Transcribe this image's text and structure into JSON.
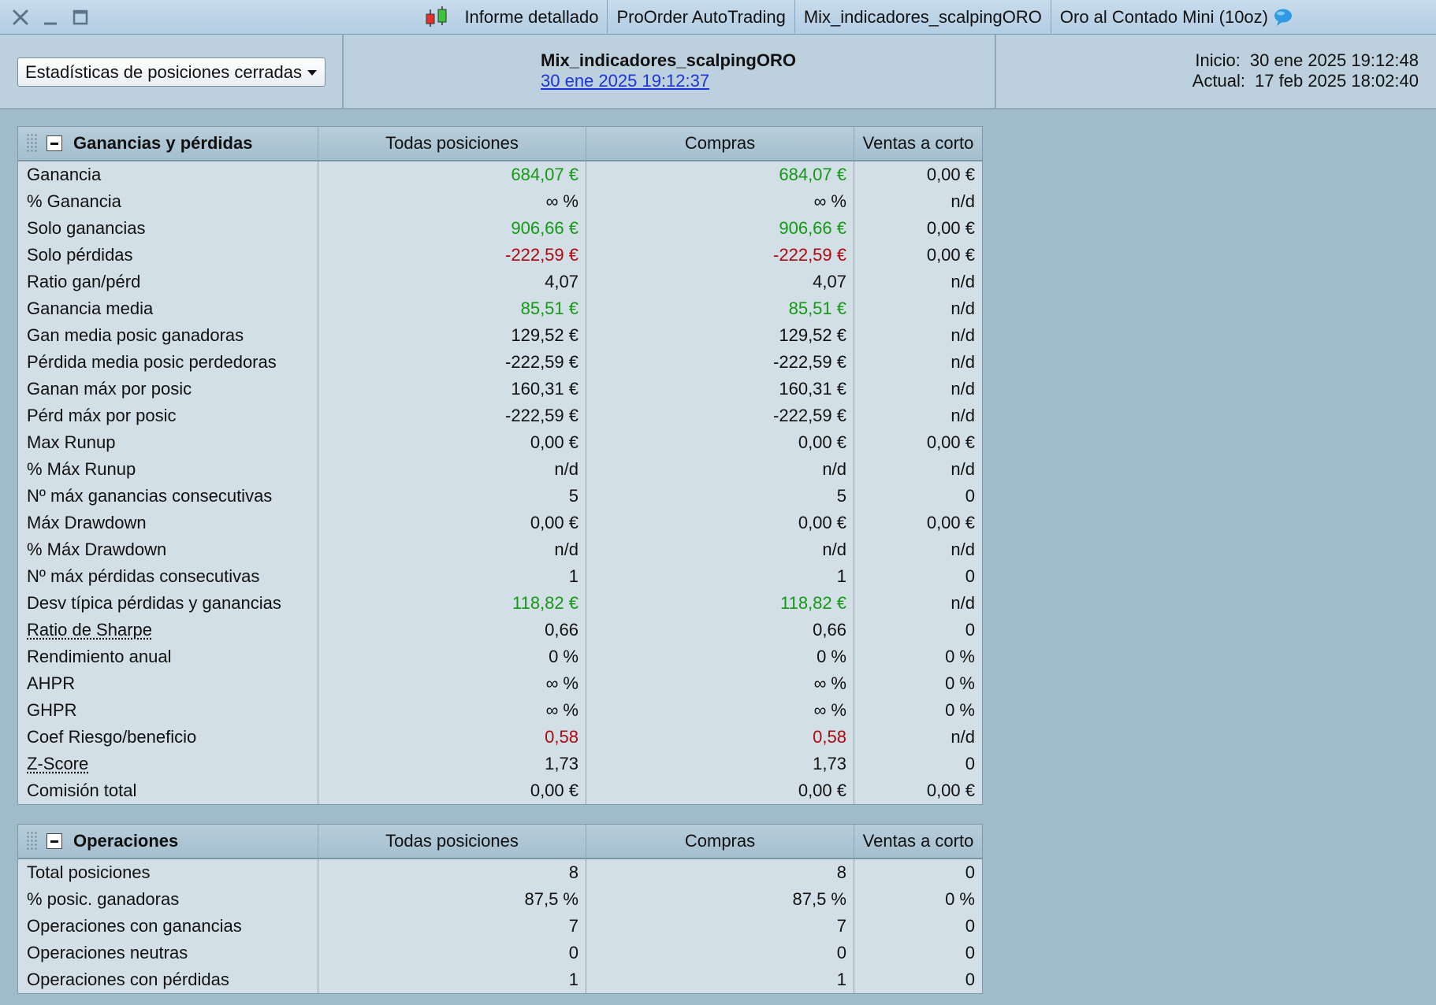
{
  "titlebar": {
    "tabs": [
      "Informe detallado",
      "ProOrder AutoTrading",
      "Mix_indicadores_scalpingORO",
      "Oro al Contado Mini (10oz)"
    ],
    "icons": [
      "close-icon",
      "minimize-icon",
      "maximize-icon",
      "candlestick-chart-icon",
      "chat-bubble-icon"
    ]
  },
  "header": {
    "dropdown_value": "Estadísticas de posiciones cerradas",
    "strategy_name": "Mix_indicadores_scalpingORO",
    "strategy_date": "30 ene 2025 19:12:37",
    "start_label": "Inicio:",
    "start_value": "30 ene 2025 19:12:48",
    "current_label": "Actual:",
    "current_value": "17 feb 2025 18:02:40"
  },
  "colors": {
    "positive": "#139a13",
    "negative": "#b0080c",
    "link": "#1b35d8"
  },
  "pnl": {
    "title": "Ganancias y pérdidas",
    "headers": [
      "Todas posiciones",
      "Compras",
      "Ventas a corto"
    ],
    "rows": [
      {
        "label": "Ganancia",
        "values": [
          "684,07 €",
          "684,07 €",
          "0,00 €"
        ],
        "tone": [
          "pos",
          "pos",
          ""
        ]
      },
      {
        "label": "% Ganancia",
        "values": [
          "∞ %",
          "∞ %",
          "n/d"
        ],
        "tone": [
          "",
          "",
          ""
        ]
      },
      {
        "label": "Solo ganancias",
        "values": [
          "906,66 €",
          "906,66 €",
          "0,00 €"
        ],
        "tone": [
          "pos",
          "pos",
          ""
        ]
      },
      {
        "label": "Solo pérdidas",
        "values": [
          "-222,59 €",
          "-222,59 €",
          "0,00 €"
        ],
        "tone": [
          "neg",
          "neg",
          ""
        ]
      },
      {
        "label": "Ratio gan/pérd",
        "values": [
          "4,07",
          "4,07",
          "n/d"
        ],
        "tone": [
          "",
          "",
          ""
        ]
      },
      {
        "label": "Ganancia media",
        "values": [
          "85,51 €",
          "85,51 €",
          "n/d"
        ],
        "tone": [
          "pos",
          "pos",
          ""
        ]
      },
      {
        "label": "Gan media posic ganadoras",
        "values": [
          "129,52 €",
          "129,52 €",
          "n/d"
        ],
        "tone": [
          "",
          "",
          ""
        ]
      },
      {
        "label": "Pérdida media posic perdedoras",
        "values": [
          "-222,59 €",
          "-222,59 €",
          "n/d"
        ],
        "tone": [
          "",
          "",
          ""
        ]
      },
      {
        "label": "Ganan máx por posic",
        "values": [
          "160,31 €",
          "160,31 €",
          "n/d"
        ],
        "tone": [
          "",
          "",
          ""
        ]
      },
      {
        "label": "Pérd máx por posic",
        "values": [
          "-222,59 €",
          "-222,59 €",
          "n/d"
        ],
        "tone": [
          "",
          "",
          ""
        ]
      },
      {
        "label": "Max Runup",
        "values": [
          "0,00 €",
          "0,00 €",
          "0,00 €"
        ],
        "tone": [
          "",
          "",
          ""
        ]
      },
      {
        "label": "% Máx Runup",
        "values": [
          "n/d",
          "n/d",
          "n/d"
        ],
        "tone": [
          "",
          "",
          ""
        ]
      },
      {
        "label": "Nº máx ganancias consecutivas",
        "values": [
          "5",
          "5",
          "0"
        ],
        "tone": [
          "",
          "",
          ""
        ]
      },
      {
        "label": "Máx Drawdown",
        "values": [
          "0,00 €",
          "0,00 €",
          "0,00 €"
        ],
        "tone": [
          "",
          "",
          ""
        ]
      },
      {
        "label": "% Máx Drawdown",
        "values": [
          "n/d",
          "n/d",
          "n/d"
        ],
        "tone": [
          "",
          "",
          ""
        ]
      },
      {
        "label": "Nº máx pérdidas consecutivas",
        "values": [
          "1",
          "1",
          "0"
        ],
        "tone": [
          "",
          "",
          ""
        ]
      },
      {
        "label": "Desv típica pérdidas y ganancias",
        "values": [
          "118,82 €",
          "118,82 €",
          "n/d"
        ],
        "tone": [
          "pos",
          "pos",
          ""
        ]
      },
      {
        "label": "Ratio de Sharpe",
        "values": [
          "0,66",
          "0,66",
          "0"
        ],
        "tone": [
          "",
          "",
          ""
        ],
        "link": true
      },
      {
        "label": "Rendimiento anual",
        "values": [
          "0 %",
          "0 %",
          "0 %"
        ],
        "tone": [
          "",
          "",
          ""
        ]
      },
      {
        "label": "AHPR",
        "values": [
          "∞ %",
          "∞ %",
          "0 %"
        ],
        "tone": [
          "",
          "",
          ""
        ]
      },
      {
        "label": "GHPR",
        "values": [
          "∞ %",
          "∞ %",
          "0 %"
        ],
        "tone": [
          "",
          "",
          ""
        ]
      },
      {
        "label": "Coef Riesgo/beneficio",
        "values": [
          "0,58",
          "0,58",
          "n/d"
        ],
        "tone": [
          "neg",
          "neg",
          ""
        ]
      },
      {
        "label": "Z-Score",
        "values": [
          "1,73",
          "1,73",
          "0"
        ],
        "tone": [
          "",
          "",
          ""
        ],
        "link": true
      },
      {
        "label": "Comisión total",
        "values": [
          "0,00 €",
          "0,00 €",
          "0,00 €"
        ],
        "tone": [
          "",
          "",
          ""
        ]
      }
    ]
  },
  "ops": {
    "title": "Operaciones",
    "headers": [
      "Todas posiciones",
      "Compras",
      "Ventas a corto"
    ],
    "rows": [
      {
        "label": "Total posiciones",
        "values": [
          "8",
          "8",
          "0"
        ],
        "tone": [
          "",
          "",
          ""
        ]
      },
      {
        "label": "% posic. ganadoras",
        "values": [
          "87,5 %",
          "87,5 %",
          "0 %"
        ],
        "tone": [
          "",
          "",
          ""
        ]
      },
      {
        "label": "Operaciones con ganancias",
        "values": [
          "7",
          "7",
          "0"
        ],
        "tone": [
          "",
          "",
          ""
        ]
      },
      {
        "label": "Operaciones neutras",
        "values": [
          "0",
          "0",
          "0"
        ],
        "tone": [
          "",
          "",
          ""
        ]
      },
      {
        "label": "Operaciones con pérdidas",
        "values": [
          "1",
          "1",
          "0"
        ],
        "tone": [
          "",
          "",
          ""
        ]
      }
    ]
  }
}
